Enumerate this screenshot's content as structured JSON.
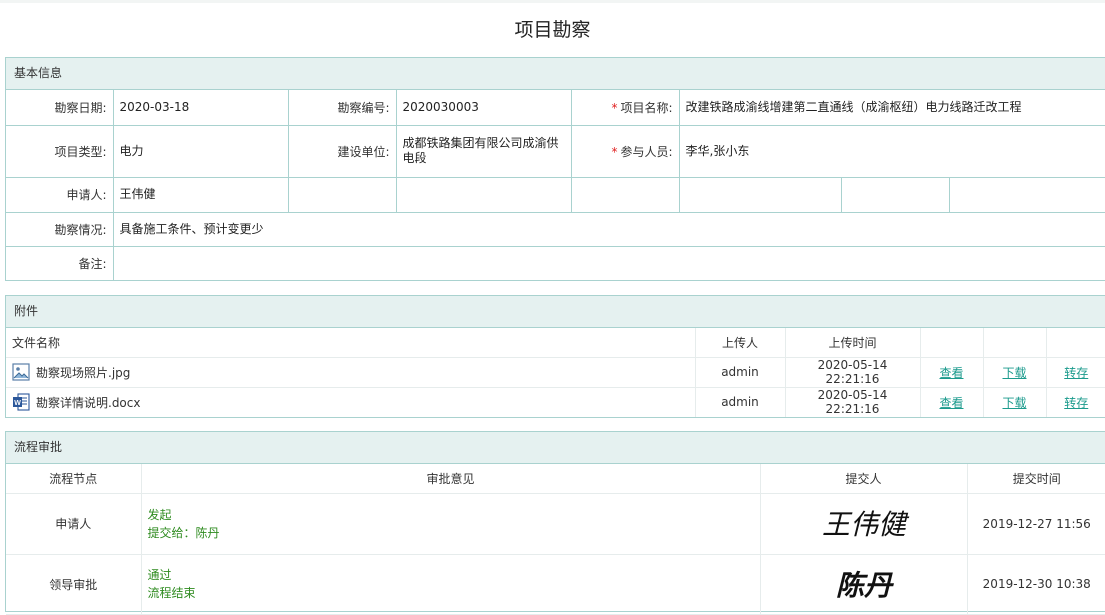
{
  "page": {
    "title": "项目勘察"
  },
  "basic": {
    "section_title": "基本信息",
    "survey_date_label": "勘察日期:",
    "survey_date": "2020-03-18",
    "survey_no_label": "勘察编号:",
    "survey_no": "2020030003",
    "project_name_label": "项目名称:",
    "project_name": "改建铁路成渝线增建第二直通线（成渝枢纽）电力线路迁改工程",
    "project_type_label": "项目类型:",
    "project_type": "电力",
    "builder_label": "建设单位:",
    "builder": "成都铁路集团有限公司成渝供电段",
    "participants_label": "参与人员:",
    "participants": "李华,张小东",
    "applicant_label": "申请人:",
    "applicant": "王伟健",
    "situation_label": "勘察情况:",
    "situation": "具备施工条件、预计变更少",
    "remark_label": "备注:",
    "remark": "",
    "required_mark": "*"
  },
  "attachments": {
    "section_title": "附件",
    "headers": {
      "file_name": "文件名称",
      "uploader": "上传人",
      "upload_time": "上传时间"
    },
    "files": [
      {
        "name": "勘察现场照片.jpg",
        "icon": "image-file-icon",
        "uploader": "admin",
        "time": "2020-05-14 22:21:16",
        "view": "查看",
        "download": "下载",
        "transfer": "转存"
      },
      {
        "name": "勘察详情说明.docx",
        "icon": "word-file-icon",
        "uploader": "admin",
        "time": "2020-05-14 22:21:16",
        "view": "查看",
        "download": "下载",
        "transfer": "转存"
      }
    ]
  },
  "workflow": {
    "section_title": "流程审批",
    "headers": {
      "node": "流程节点",
      "opinion": "审批意见",
      "submitter": "提交人",
      "time": "提交时间"
    },
    "rows": [
      {
        "node": "申请人",
        "opinion_line1": "发起",
        "opinion_line2": "提交给：陈丹",
        "signature": "王伟健",
        "time": "2019-12-27 11:56"
      },
      {
        "node": "领导审批",
        "opinion_line1": "通过",
        "opinion_line2": "流程结束",
        "signature": "陈丹",
        "time": "2019-12-30 10:38"
      }
    ]
  },
  "colors": {
    "panel_border": "#a9d2cf",
    "panel_head_bg": "#e5f1f0",
    "link": "#1a9a8c",
    "opinion_text": "#2e8b1f",
    "required": "#e02020"
  }
}
